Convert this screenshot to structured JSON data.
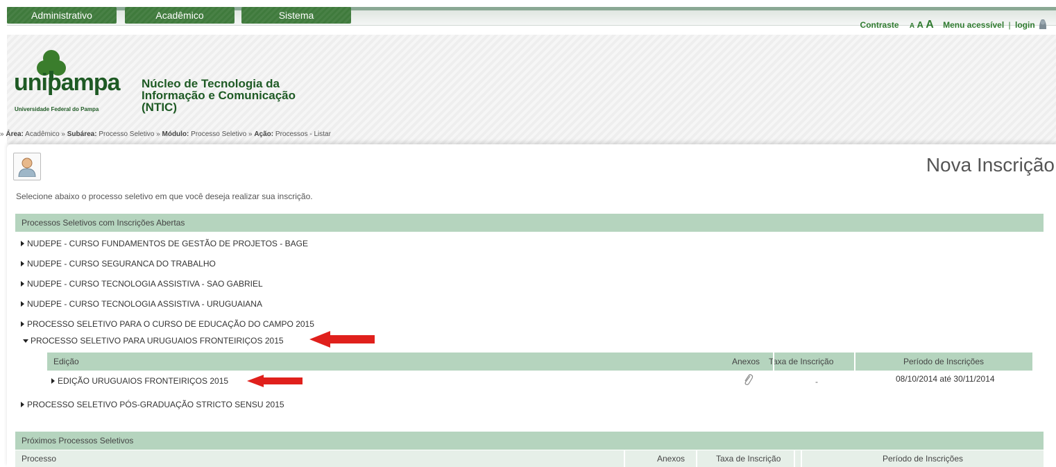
{
  "topnav": {
    "tabs": [
      "Administrativo",
      "Acadêmico",
      "Sistema"
    ]
  },
  "accessibility": {
    "contrast": "Contraste",
    "font_small": "A",
    "font_medium": "A",
    "font_large": "A",
    "menu": "Menu acessível",
    "separator": "|",
    "login": "login"
  },
  "header": {
    "logo_word": "unipampa",
    "logo_sub": "Universidade Federal do Pampa",
    "ntic": "Núcleo de Tecnologia da Informação e Comunicação (NTIC)"
  },
  "breadcrumb": {
    "prefix": "»",
    "area_label": "Área:",
    "area_value": "Acadêmico",
    "sep1": "»",
    "subarea_label": "Subárea:",
    "subarea_value": "Processo Seletivo",
    "sep2": "»",
    "modulo_label": "Módulo:",
    "modulo_value": "Processo Seletivo",
    "sep3": "»",
    "acao_label": "Ação:",
    "acao_value": "Processos - Listar"
  },
  "page": {
    "title": "Nova Inscrição",
    "instructions": "Selecione abaixo o processo seletivo em que você deseja realizar sua inscrição."
  },
  "open_section": {
    "title": "Processos Seletivos com Inscrições Abertas",
    "processes": [
      "NUDEPE - CURSO FUNDAMENTOS DE GESTÃO DE PROJETOS - BAGE",
      "NUDEPE - CURSO SEGURANCA DO TRABALHO",
      "NUDEPE - CURSO TECNOLOGIA ASSISTIVA - SAO GABRIEL",
      "NUDEPE - CURSO TECNOLOGIA ASSISTIVA - URUGUAIANA",
      "PROCESSO SELETIVO PARA O CURSO DE EDUCAÇÃO DO CAMPO 2015",
      "PROCESSO SELETIVO PARA URUGUAIOS FRONTEIRIÇOS 2015",
      "PROCESSO SELETIVO PÓS-GRADUAÇÃO STRICTO SENSU 2015"
    ],
    "edition_table": {
      "headers": {
        "edicao": "Edição",
        "anexos": "Anexos",
        "taxa": "Taxa de Inscrição",
        "periodo": "Período de Inscrições"
      },
      "row": {
        "edicao": "EDIÇÃO URUGUAIOS FRONTEIRIÇOS 2015",
        "taxa": "-",
        "periodo": "08/10/2014 até 30/11/2014"
      }
    }
  },
  "next_section": {
    "title": "Próximos Processos Seletivos",
    "headers": {
      "processo": "Processo",
      "anexos": "Anexos",
      "taxa": "Taxa de Inscrição",
      "periodo": "Período de Inscrições"
    }
  },
  "colors": {
    "brand_green": "#1e5a24",
    "tab_green": "#3f7a3c",
    "section_bar": "#b5d4be",
    "arrow_red": "#e0201c"
  }
}
